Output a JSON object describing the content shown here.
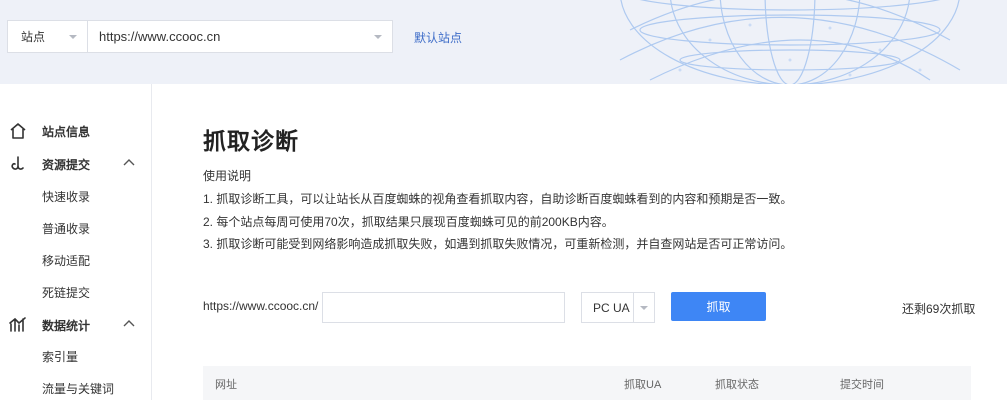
{
  "header": {
    "site_select_label": "站点",
    "url_value": "https://www.ccooc.cn",
    "default_site_link": "默认站点"
  },
  "sidebar": {
    "groups": [
      {
        "label": "站点信息",
        "icon": "home-icon",
        "items": []
      },
      {
        "label": "资源提交",
        "icon": "submit-icon",
        "items": [
          "快速收录",
          "普通收录",
          "移动适配",
          "死链提交"
        ]
      },
      {
        "label": "数据统计",
        "icon": "stats-icon",
        "items": [
          "索引量",
          "流量与关键词"
        ]
      }
    ]
  },
  "main": {
    "title": "抓取诊断",
    "instructions_title": "使用说明",
    "instructions": [
      "1. 抓取诊断工具，可以让站长从百度蜘蛛的视角查看抓取内容，自助诊断百度蜘蛛看到的内容和预期是否一致。",
      "2. 每个站点每周可使用70次，抓取结果只展现百度蜘蛛可见的前200KB内容。",
      "3. 抓取诊断可能受到网络影响造成抓取失败，如遇到抓取失败情况，可重新检测，并自查网站是否可正常访问。"
    ],
    "fetch_prefix": "https://www.ccooc.cn/",
    "fetch_input_value": "",
    "ua_value": "PC UA",
    "fetch_button": "抓取",
    "remaining_text": "还剩69次抓取",
    "table_headers": [
      "网址",
      "抓取UA",
      "抓取状态",
      "提交时间"
    ]
  },
  "colors": {
    "accent": "#3e86f5",
    "link": "#3e6dc8",
    "header_bg": "#eef1f8"
  }
}
